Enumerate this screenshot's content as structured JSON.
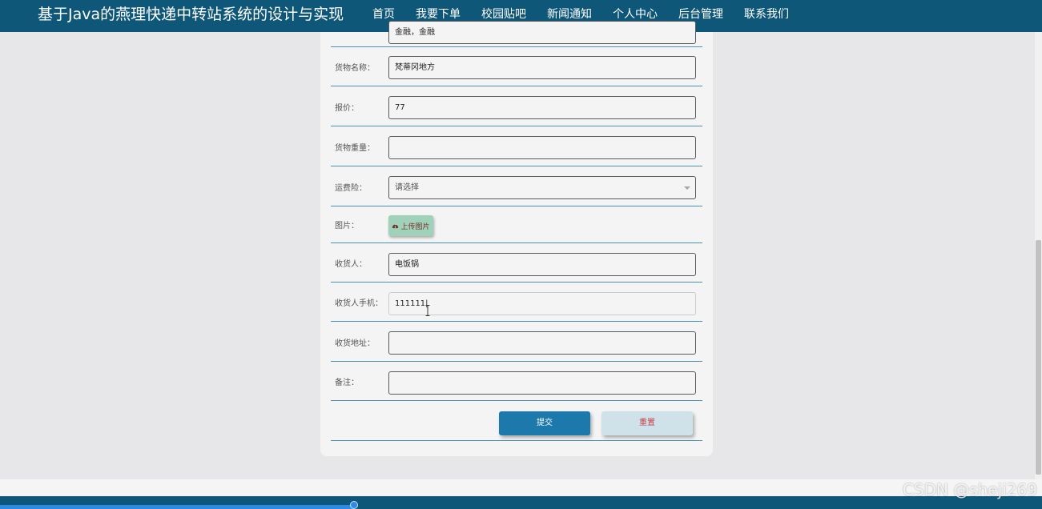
{
  "header": {
    "site_title": "基于Java的燕理快递中转站系统的设计与实现",
    "nav": [
      {
        "label": "首页"
      },
      {
        "label": "我要下单"
      },
      {
        "label": "校园贴吧"
      },
      {
        "label": "新闻通知"
      },
      {
        "label": "个人中心"
      },
      {
        "label": "后台管理"
      },
      {
        "label": "联系我们"
      }
    ],
    "active_nav_index": 1
  },
  "form": {
    "partial_row_value": "金融，金融",
    "rows": [
      {
        "label": "货物名称：",
        "value": "梵蒂冈地方"
      },
      {
        "label": "报价：",
        "value": "77"
      },
      {
        "label": "货物重量：",
        "value": ""
      },
      {
        "label": "运费险：",
        "value": "请选择",
        "type": "select"
      },
      {
        "label": "图片：",
        "button": "上传图片",
        "type": "upload"
      },
      {
        "label": "收货人：",
        "value": "电饭锅"
      },
      {
        "label": "收货人手机：",
        "value": "111111|",
        "focused": true
      },
      {
        "label": "收货地址：",
        "value": ""
      },
      {
        "label": "备注：",
        "value": ""
      }
    ],
    "submit_label": "提交",
    "reset_label": "重置"
  },
  "watermark": "CSDN @sheji269",
  "colors": {
    "header_bg": "#0f5779",
    "submit_bg": "#1d79ac",
    "reset_bg": "#cfe2ea",
    "upload_bg": "#9fd2b8",
    "row_divider": "#4c8fb0"
  }
}
